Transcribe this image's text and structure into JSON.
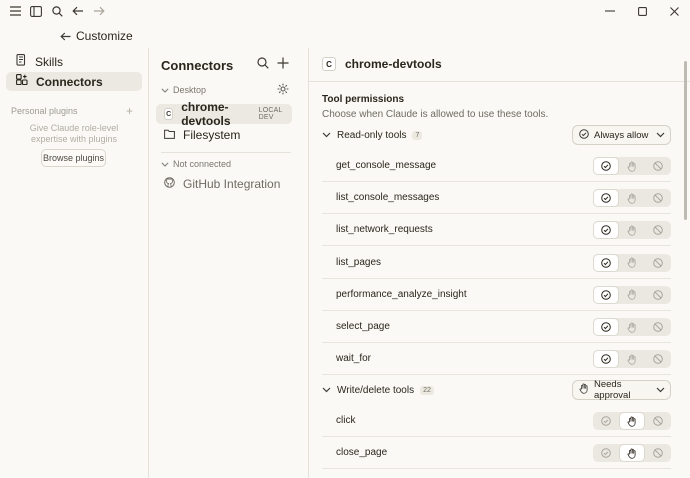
{
  "titlebar": {
    "icons": [
      "menu-icon",
      "sidebar-toggle-icon",
      "search-icon",
      "back-arrow-icon",
      "forward-arrow-icon"
    ],
    "window_controls": [
      "minimize-icon",
      "maximize-icon",
      "close-icon"
    ]
  },
  "subbar": {
    "title": "Customize"
  },
  "sidebar": {
    "items": [
      {
        "label": "Skills",
        "icon": "skills-icon",
        "active": false
      },
      {
        "label": "Connectors",
        "icon": "connectors-icon",
        "active": true
      }
    ],
    "personal_plugins_label": "Personal plugins",
    "personal_plugins_desc": "Give Claude role-level expertise with plugins",
    "browse_button": "Browse plugins"
  },
  "connectors": {
    "title": "Connectors",
    "groups": {
      "desktop": "Desktop",
      "not_connected": "Not connected"
    },
    "items": [
      {
        "label": "chrome-devtools",
        "badge": "C",
        "tag": "LOCAL DEV",
        "active": true
      },
      {
        "label": "Filesystem",
        "icon": "folder-icon",
        "active": false
      },
      {
        "label": "GitHub Integration",
        "icon": "github-icon",
        "active": false
      }
    ]
  },
  "detail": {
    "badge": "C",
    "title": "chrome-devtools",
    "perm_title": "Tool permissions",
    "perm_subtitle": "Choose when Claude is allowed to use these tools.",
    "sections": [
      {
        "label": "Read-only tools",
        "count": "7",
        "dropdown": "Always allow",
        "tools": [
          {
            "name": "get_console_message",
            "state": "allow"
          },
          {
            "name": "list_console_messages",
            "state": "allow"
          },
          {
            "name": "list_network_requests",
            "state": "allow"
          },
          {
            "name": "list_pages",
            "state": "allow"
          },
          {
            "name": "performance_analyze_insight",
            "state": "allow"
          },
          {
            "name": "select_page",
            "state": "allow"
          },
          {
            "name": "wait_for",
            "state": "allow"
          }
        ]
      },
      {
        "label": "Write/delete tools",
        "count": "22",
        "dropdown": "Needs approval",
        "tools": [
          {
            "name": "click",
            "state": "approval"
          },
          {
            "name": "close_page",
            "state": "approval"
          }
        ]
      }
    ]
  }
}
